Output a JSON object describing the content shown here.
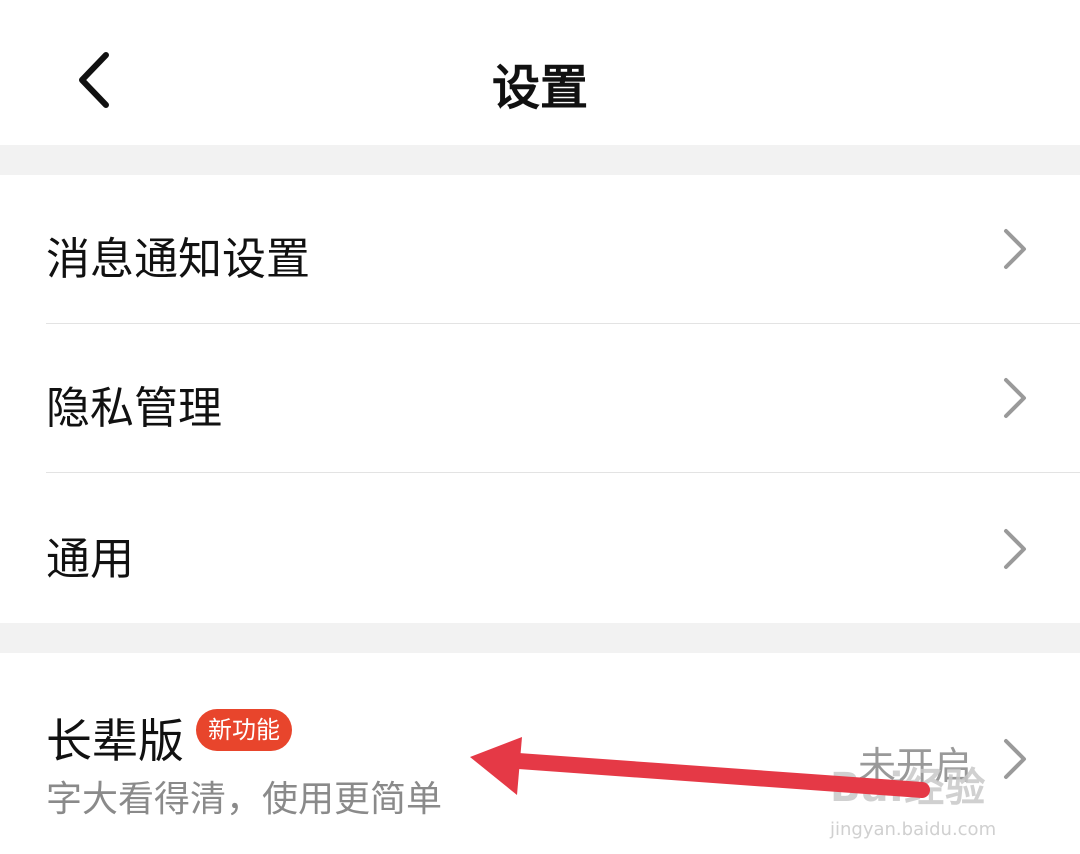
{
  "header": {
    "title": "设置"
  },
  "menu": {
    "notification": "消息通知设置",
    "privacy": "隐私管理",
    "general": "通用"
  },
  "elder_mode": {
    "label": "长辈版",
    "badge": "新功能",
    "description": "字大看得清，使用更简单",
    "status": "未开启"
  },
  "watermark": {
    "main": "Bai经验",
    "sub": "jingyan.baidu.com"
  },
  "colors": {
    "badge": "#e8452c",
    "annotation_arrow": "#e53946",
    "section_gap": "#f2f2f2"
  },
  "icons": [
    "back-arrow-icon",
    "chevron-right-icon"
  ]
}
